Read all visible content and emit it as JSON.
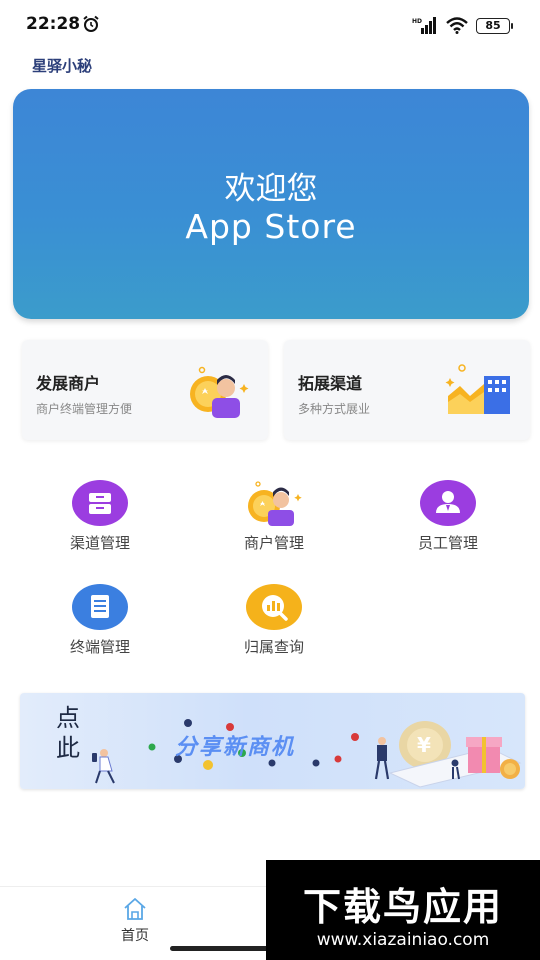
{
  "status_bar": {
    "time": "22:28",
    "battery": "85"
  },
  "app": {
    "title": "星驿小秘"
  },
  "hero": {
    "line1": "欢迎您",
    "line2": "App Store"
  },
  "cards": [
    {
      "title": "发展商户",
      "subtitle": "商户终端管理方便"
    },
    {
      "title": "拓展渠道",
      "subtitle": "多种方式展业"
    }
  ],
  "grid": [
    {
      "label": "渠道管理",
      "icon": "box-icon",
      "color": "#9b3de0"
    },
    {
      "label": "商户管理",
      "icon": "merchant-icon",
      "color": "#f5b21b"
    },
    {
      "label": "员工管理",
      "icon": "person-icon",
      "color": "#9b3de0"
    },
    {
      "label": "终端管理",
      "icon": "document-icon",
      "color": "#3b7fe0"
    },
    {
      "label": "归属查询",
      "icon": "search-chart-icon",
      "color": "#f5b21b"
    }
  ],
  "promo": {
    "text": "分享新商机",
    "side_text": "点此",
    "coin_symbol": "¥"
  },
  "nav": {
    "home_label": "首页"
  },
  "watermark": {
    "brand": "下载鸟应用",
    "url": "www.xiazainiao.com"
  }
}
